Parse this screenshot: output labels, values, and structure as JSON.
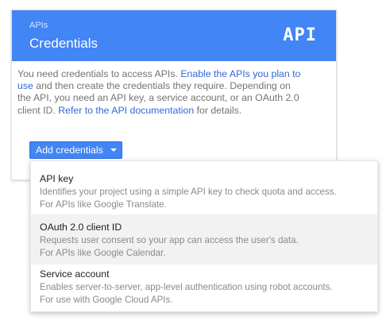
{
  "header": {
    "subtitle": "APIs",
    "title": "Credentials",
    "logo_text": "API"
  },
  "body": {
    "line1_pre": "You need credentials to access APIs. ",
    "line1_link": "Enable the APIs you plan to",
    "line2_link": "use",
    "line2_post": " and then create the credentials they require. Depending on",
    "line3": "the API, you need an API key, a service account, or an OAuth 2.0",
    "line4_pre": "client ID. ",
    "line4_link": "Refer to the API documentation",
    "line4_post": " for details."
  },
  "add_button": {
    "label": "Add credentials"
  },
  "menu": {
    "items": [
      {
        "title": "API key",
        "desc1": "Identifies your project using a simple API key to check quota and access.",
        "desc2": "For APIs like Google Translate."
      },
      {
        "title": "OAuth 2.0 client ID",
        "desc1": "Requests user consent so your app can access the user's data.",
        "desc2": "For APIs like Google Calendar."
      },
      {
        "title": "Service account",
        "desc1": "Enables server-to-server, app-level authentication using robot accounts.",
        "desc2": "For use with Google Cloud APIs."
      }
    ]
  },
  "colors": {
    "accent": "#4285f4",
    "link": "#3367d6",
    "highlight": "#f2f2f2"
  }
}
